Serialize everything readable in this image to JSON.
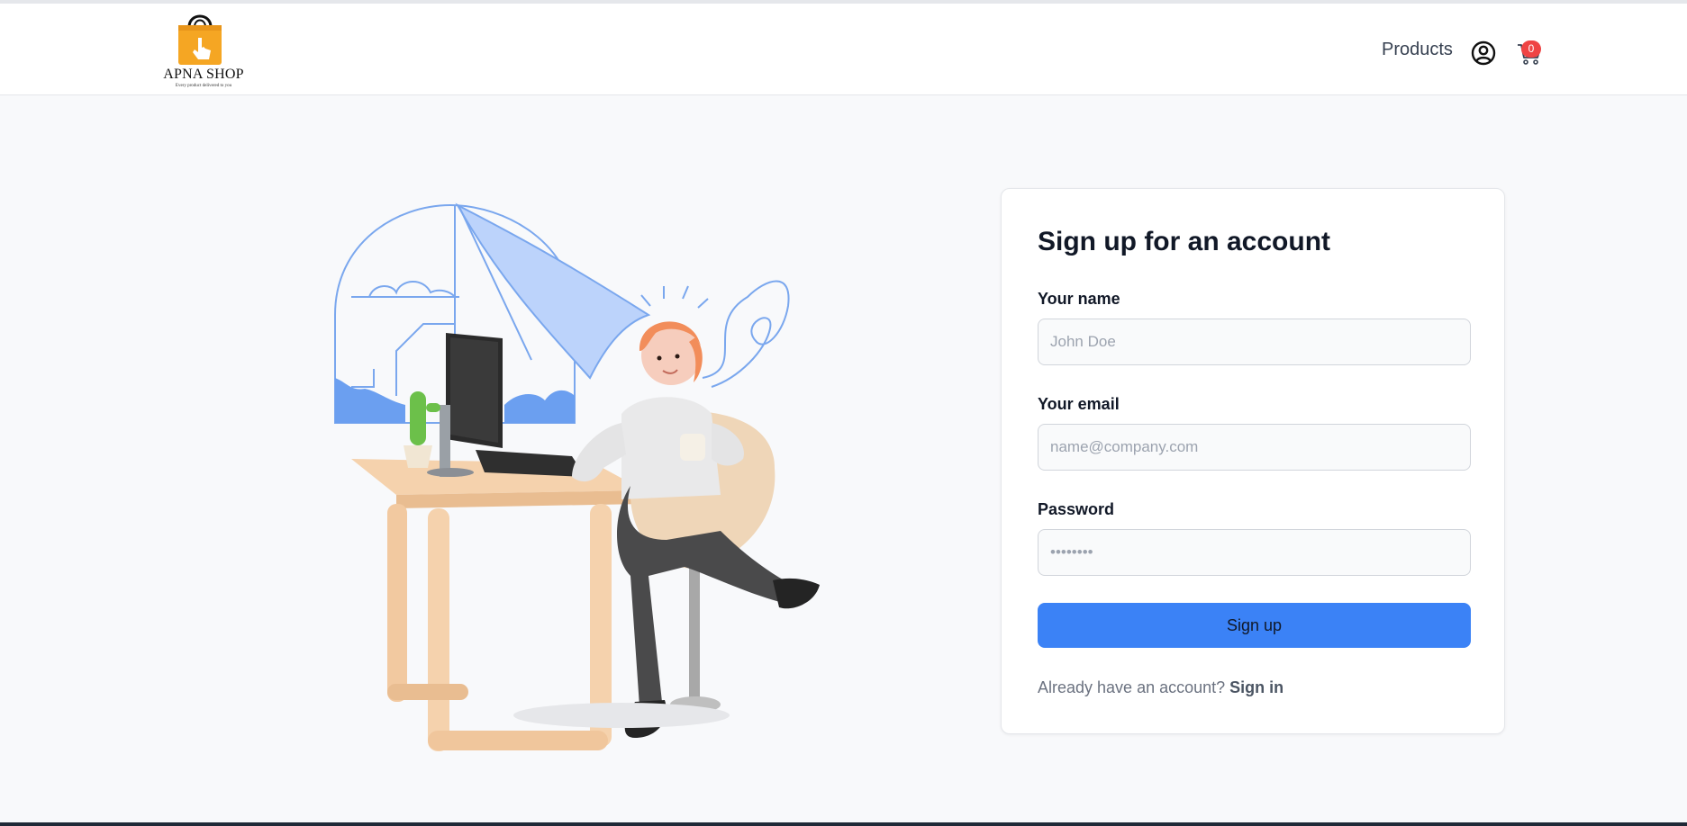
{
  "brand": {
    "name": "APNA SHOP",
    "tagline": "Every product delivered to you",
    "bag_color": "#f5a623"
  },
  "nav": {
    "products_label": "Products",
    "account_icon": "user-circle-icon",
    "cart_icon": "shopping-cart-icon",
    "cart_count": "0",
    "badge_color": "#ef4444"
  },
  "illustration": {
    "description_icon": "woman-at-desk-illustration"
  },
  "form": {
    "title": "Sign up for an account",
    "name_label": "Your name",
    "name_placeholder": "John Doe",
    "email_label": "Your email",
    "email_placeholder": "name@company.com",
    "password_label": "Password",
    "password_value": "••••••••",
    "submit_label": "Sign up",
    "have_account_text": "Already have an account?",
    "signin_label": "Sign in",
    "accent_color": "#3b82f6"
  }
}
